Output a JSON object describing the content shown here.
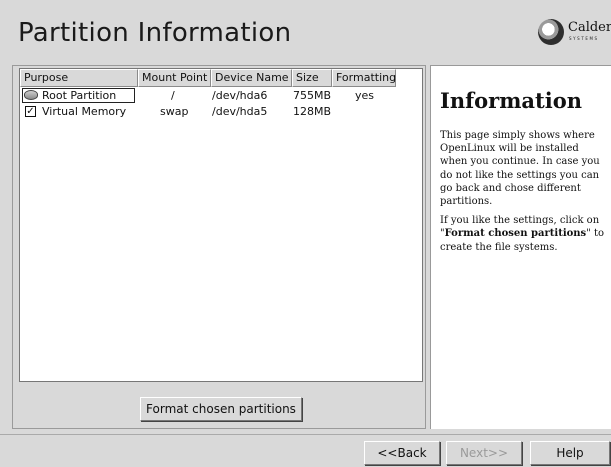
{
  "header": {
    "title": "Partition Information",
    "logo_text": "Caldera",
    "logo_sub": "SYSTEMS"
  },
  "partition_table": {
    "columns": [
      "Purpose",
      "Mount Point",
      "Device Name",
      "Size",
      "Formatting"
    ],
    "rows": [
      {
        "icon": "disk-icon",
        "purpose": "Root Partition",
        "mount": "/",
        "device": "/dev/hda6",
        "size": "755MB",
        "formatting": "yes"
      },
      {
        "icon": "checkbox-checked-icon",
        "purpose": "Virtual Memory",
        "mount": "swap",
        "device": "/dev/hda5",
        "size": "128MB",
        "formatting": ""
      }
    ]
  },
  "buttons": {
    "format": "Format chosen partitions",
    "back": "<<Back",
    "next": "Next>>",
    "help": "Help"
  },
  "info": {
    "title": "Information",
    "para1": "This page simply shows where OpenLinux will be installed when you continue. In case you do not like the settings you can go back and chose different partitions.",
    "para2_prefix": "If you like the settings, click on \"",
    "para2_bold": "Format chosen partitions",
    "para2_suffix": "\" to create the file systems."
  }
}
